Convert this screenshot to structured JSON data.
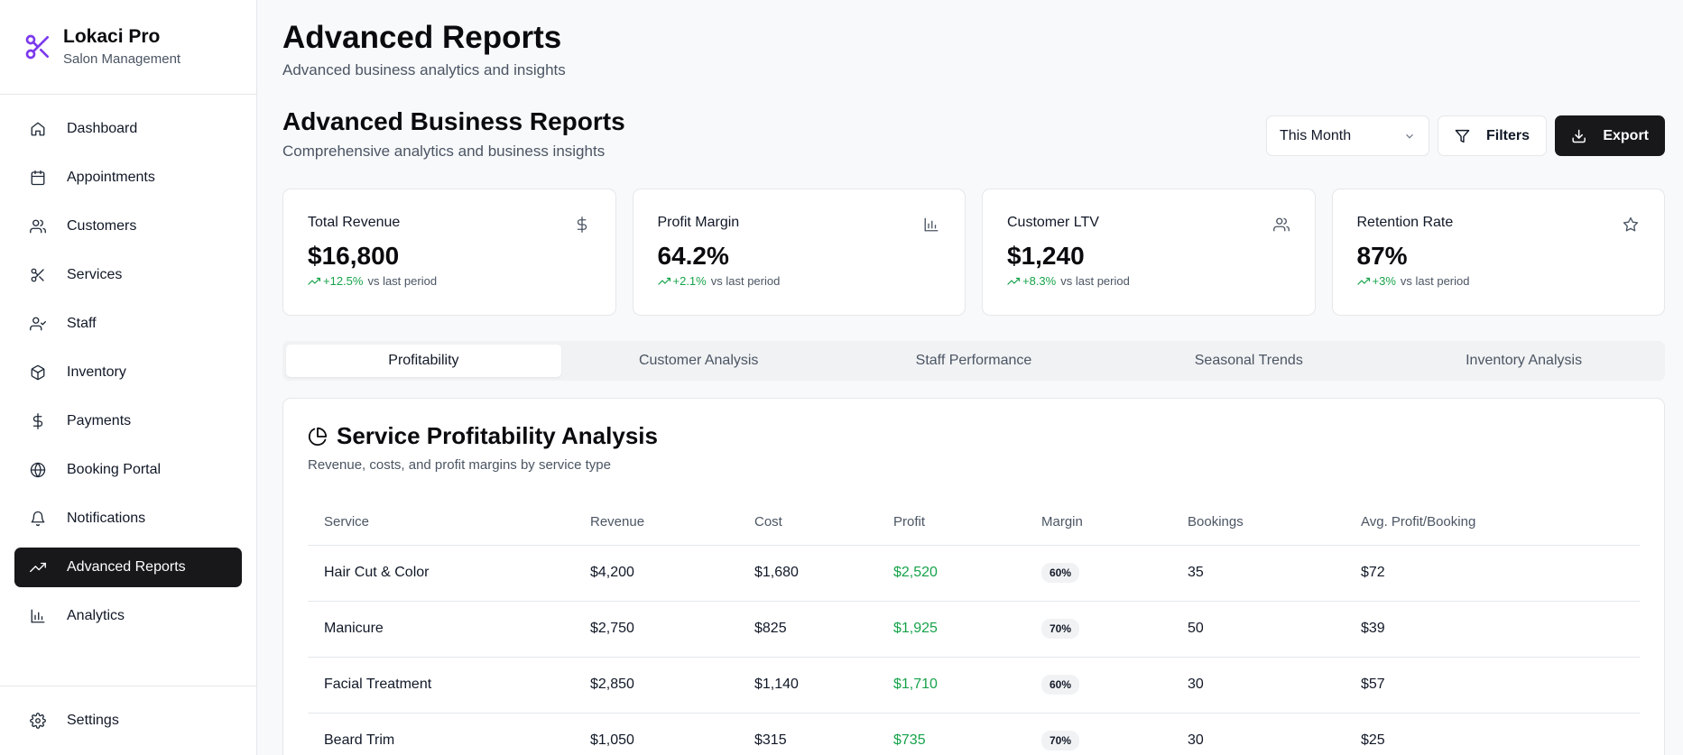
{
  "brand": {
    "name": "Lokaci Pro",
    "tagline": "Salon Management",
    "accent": "#7c3aed"
  },
  "sidebar": {
    "items": [
      {
        "label": "Dashboard",
        "icon": "home-icon"
      },
      {
        "label": "Appointments",
        "icon": "calendar-icon"
      },
      {
        "label": "Customers",
        "icon": "users-icon"
      },
      {
        "label": "Services",
        "icon": "scissors-icon"
      },
      {
        "label": "Staff",
        "icon": "user-check-icon"
      },
      {
        "label": "Inventory",
        "icon": "package-icon"
      },
      {
        "label": "Payments",
        "icon": "dollar-icon"
      },
      {
        "label": "Booking Portal",
        "icon": "globe-icon"
      },
      {
        "label": "Notifications",
        "icon": "bell-icon"
      },
      {
        "label": "Advanced Reports",
        "icon": "trending-up-icon",
        "active": true
      },
      {
        "label": "Analytics",
        "icon": "bar-chart-icon"
      }
    ],
    "settings": {
      "label": "Settings",
      "icon": "gear-icon"
    }
  },
  "header": {
    "title": "Advanced Reports",
    "subtitle": "Advanced business analytics and insights"
  },
  "section": {
    "title": "Advanced Business Reports",
    "subtitle": "Comprehensive analytics and business insights"
  },
  "toolbar": {
    "period": "This Month",
    "filters_label": "Filters",
    "export_label": "Export"
  },
  "kpis": [
    {
      "title": "Total Revenue",
      "value": "$16,800",
      "change": "+12.5%",
      "suffix": "vs last period",
      "icon": "dollar-icon"
    },
    {
      "title": "Profit Margin",
      "value": "64.2%",
      "change": "+2.1%",
      "suffix": "vs last period",
      "icon": "bar-chart-icon"
    },
    {
      "title": "Customer LTV",
      "value": "$1,240",
      "change": "+8.3%",
      "suffix": "vs last period",
      "icon": "users-icon"
    },
    {
      "title": "Retention Rate",
      "value": "87%",
      "change": "+3%",
      "suffix": "vs last period",
      "icon": "star-icon"
    }
  ],
  "tabs": [
    {
      "label": "Profitability",
      "active": true
    },
    {
      "label": "Customer Analysis"
    },
    {
      "label": "Staff Performance"
    },
    {
      "label": "Seasonal Trends"
    },
    {
      "label": "Inventory Analysis"
    }
  ],
  "panel": {
    "title": "Service Profitability Analysis",
    "subtitle": "Revenue, costs, and profit margins by service type",
    "columns": [
      "Service",
      "Revenue",
      "Cost",
      "Profit",
      "Margin",
      "Bookings",
      "Avg. Profit/Booking"
    ],
    "rows": [
      [
        "Hair Cut & Color",
        "$4,200",
        "$1,680",
        "$2,520",
        "60%",
        "35",
        "$72"
      ],
      [
        "Manicure",
        "$2,750",
        "$825",
        "$1,925",
        "70%",
        "50",
        "$39"
      ],
      [
        "Facial Treatment",
        "$2,850",
        "$1,140",
        "$1,710",
        "60%",
        "30",
        "$57"
      ],
      [
        "Beard Trim",
        "$1,050",
        "$315",
        "$735",
        "70%",
        "30",
        "$25"
      ]
    ]
  },
  "colors": {
    "positive": "#16a34a",
    "active_nav": "#18181b"
  }
}
